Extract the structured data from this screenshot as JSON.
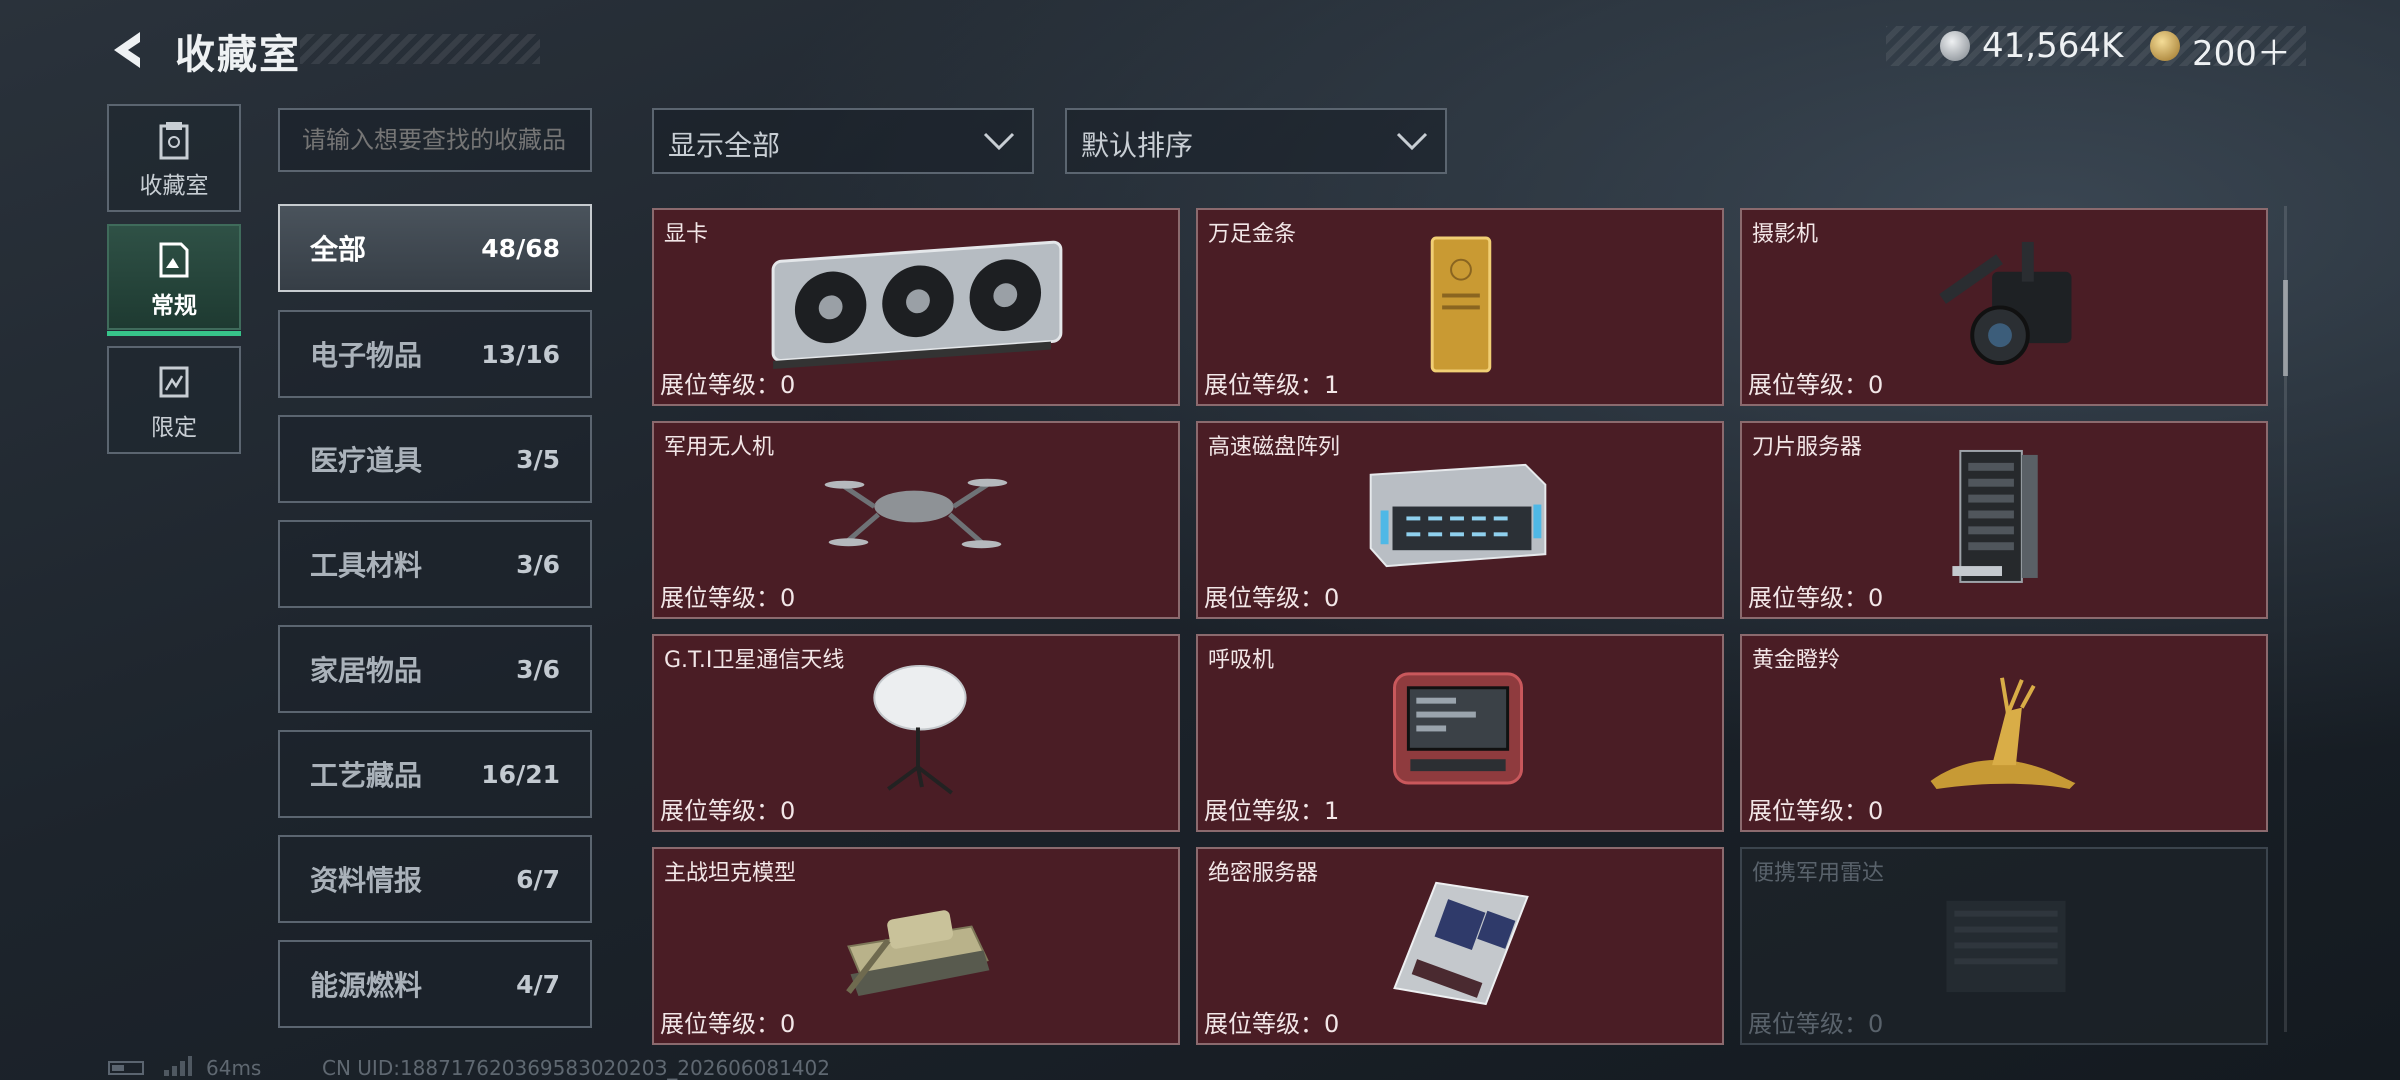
{
  "header": {
    "title": "收藏室"
  },
  "currency": {
    "silver": "41,564K",
    "gold": "200＋",
    "colors": {
      "silver": "#b9bfc6",
      "gold": "#c9a04a"
    }
  },
  "left_nav": [
    {
      "label": "收藏室",
      "icon": "collection-room-icon",
      "active": false
    },
    {
      "label": "常规",
      "icon": "regular-icon",
      "active": true
    },
    {
      "label": "限定",
      "icon": "limited-icon",
      "active": false
    }
  ],
  "search": {
    "placeholder": "请输入想要查找的收藏品",
    "value": ""
  },
  "categories": [
    {
      "name": "全部",
      "count": "48/68"
    },
    {
      "name": "电子物品",
      "count": "13/16"
    },
    {
      "name": "医疗道具",
      "count": "3/5"
    },
    {
      "name": "工具材料",
      "count": "3/6"
    },
    {
      "name": "家居物品",
      "count": "3/6"
    },
    {
      "name": "工艺藏品",
      "count": "16/21"
    },
    {
      "name": "资料情报",
      "count": "6/7"
    },
    {
      "name": "能源燃料",
      "count": "4/7"
    }
  ],
  "filters": {
    "display": "显示全部",
    "sort": "默认排序"
  },
  "items": [
    {
      "name": "显卡",
      "level": "展位等级：0",
      "icon": "graphics-card-icon"
    },
    {
      "name": "万足金条",
      "level": "展位等级：1",
      "icon": "gold-bar-icon"
    },
    {
      "name": "摄影机",
      "level": "展位等级：0",
      "icon": "video-camera-icon"
    },
    {
      "name": "军用无人机",
      "level": "展位等级：0",
      "icon": "drone-icon"
    },
    {
      "name": "高速磁盘阵列",
      "level": "展位等级：0",
      "icon": "disk-array-icon"
    },
    {
      "name": "刀片服务器",
      "level": "展位等级：0",
      "icon": "blade-server-icon"
    },
    {
      "name": "G.T.I卫星通信天线",
      "level": "展位等级：0",
      "icon": "satellite-dish-icon"
    },
    {
      "name": "呼吸机",
      "level": "展位等级：1",
      "icon": "ventilator-icon"
    },
    {
      "name": "黄金瞪羚",
      "level": "展位等级：0",
      "icon": "golden-gazelle-icon"
    },
    {
      "name": "主战坦克模型",
      "level": "展位等级：0",
      "icon": "tank-model-icon"
    },
    {
      "name": "绝密服务器",
      "level": "展位等级：0",
      "icon": "secret-server-icon"
    },
    {
      "name": "便携军用雷达",
      "level": "展位等级：0",
      "icon": "radar-icon",
      "locked": true
    }
  ],
  "footer": {
    "ping": "64ms",
    "uid": "CN UID:18871762036958302020З_202606081402"
  }
}
